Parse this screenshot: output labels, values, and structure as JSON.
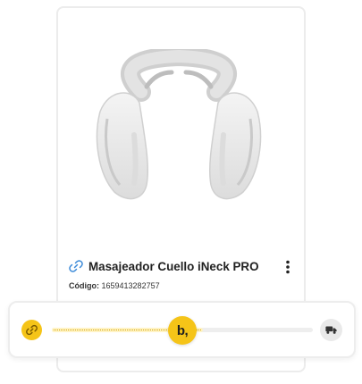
{
  "product": {
    "title": "Masajeador Cuello iNeck PRO",
    "code_label": "Código:",
    "code_value": "1659413282757",
    "image_icon": "neck-massager-image",
    "link_icon": "link-icon",
    "menu_icon": "kebab-menu-icon"
  },
  "tracker": {
    "start_icon": "link-icon",
    "thumb_text": "b,",
    "end_icon": "truck-icon",
    "progress": 0.58,
    "colors": {
      "accent": "#f5c418",
      "track": "#eeeeee",
      "progress_fill": "#fff3c4",
      "end_badge": "#e9e9e9"
    }
  },
  "colors": {
    "link_icon": "#3d8bd9",
    "title_text": "#222222"
  }
}
